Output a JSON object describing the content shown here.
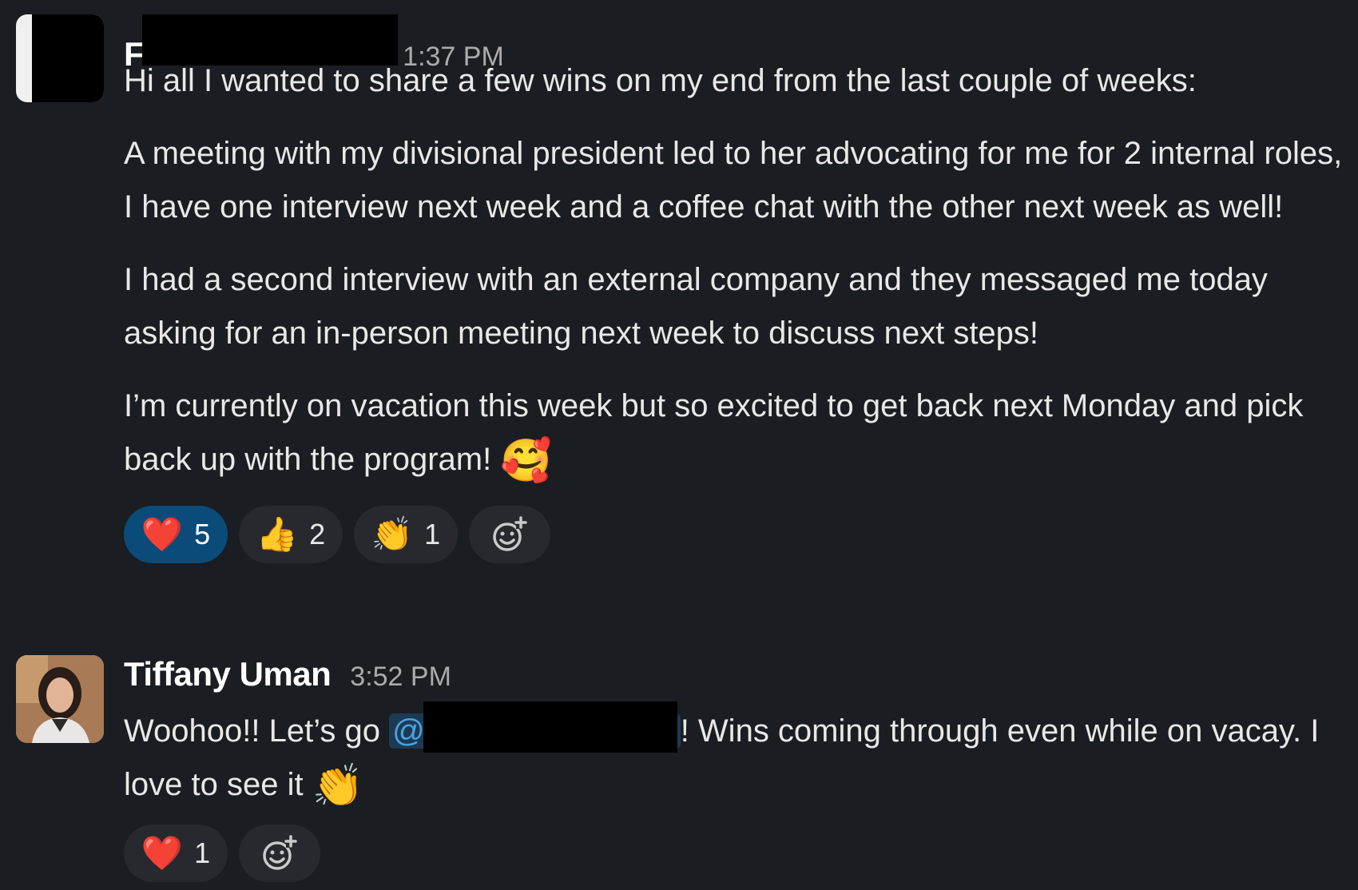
{
  "messages": [
    {
      "sender": "F",
      "time": "1:37 PM",
      "paragraphs": [
        "Hi all I wanted to share a few wins on my end from the last couple of weeks:",
        "A meeting with my divisional president led to her advocating for me for 2 internal roles, I have one interview next week and a coffee chat with the other next week as well!",
        "I had a second interview with an external company and they messaged me today asking for an in-person meeting next week to discuss next steps!",
        "I’m currently on vacation this week but so excited to get back next Monday and pick back up with the program!"
      ],
      "trailing_emoji": "🥰",
      "reactions": [
        {
          "emoji": "❤️",
          "count": "5",
          "active": true
        },
        {
          "emoji": "👍",
          "count": "2",
          "active": false
        },
        {
          "emoji": "👏",
          "count": "1",
          "active": false
        }
      ]
    },
    {
      "sender": "Tiffany Uman",
      "time": "3:52 PM",
      "text_before_mention": "Woohoo!! Let’s go ",
      "mention_prefix": "@",
      "text_after_mention": "! Wins coming through even while on vacay. I love to see it ",
      "trailing_emoji": "👏",
      "reactions": [
        {
          "emoji": "❤️",
          "count": "1",
          "active": false
        }
      ]
    }
  ],
  "icons": {
    "add_reaction": "add-reaction-icon"
  },
  "colors": {
    "background": "#1a1d21",
    "active_reaction": "#0b4b7a",
    "mention": "#4aa3df"
  }
}
